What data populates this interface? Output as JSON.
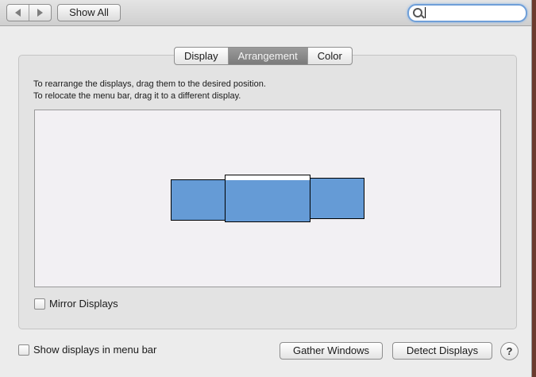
{
  "toolbar": {
    "show_all_label": "Show All",
    "search": {
      "value": "",
      "placeholder": ""
    }
  },
  "tabs": [
    {
      "label": "Display",
      "selected": false
    },
    {
      "label": "Arrangement",
      "selected": true
    },
    {
      "label": "Color",
      "selected": false
    }
  ],
  "arrangement": {
    "instruction_1": "To rearrange the displays, drag them to the desired position.",
    "instruction_2": "To relocate the menu bar, drag it to a different display.",
    "display_color": "#659bd6",
    "canvas_color": "#f2f0f3",
    "mirror_label": "Mirror Displays",
    "mirror_checked": false
  },
  "footer": {
    "show_in_menubar_label": "Show displays in menu bar",
    "show_in_menubar_checked": false,
    "gather_label": "Gather Windows",
    "detect_label": "Detect Displays",
    "help_label": "?"
  }
}
